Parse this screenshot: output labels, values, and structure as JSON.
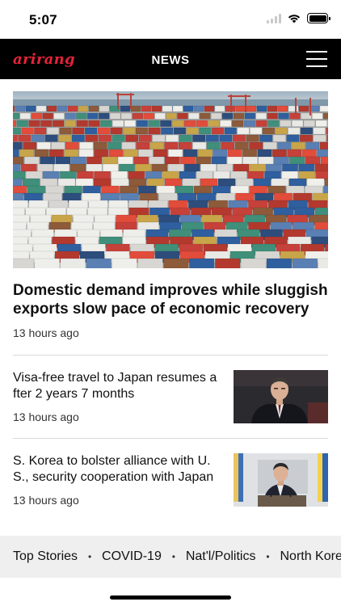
{
  "status_bar": {
    "time": "5:07"
  },
  "header": {
    "logo": "arirang",
    "title": "NEWS",
    "brand_color": "#e2233a"
  },
  "hero": {
    "title": "Domestic demand improves while sluggish exports slow pace of economic recovery",
    "time": "13 hours ago"
  },
  "articles": [
    {
      "title": "Visa-free travel to Japan resumes after 2 years 7 months",
      "time": "13 hours ago"
    },
    {
      "title": "S. Korea to bolster alliance with U.S., security cooperation with Japan",
      "time": "13 hours ago"
    }
  ],
  "categories": [
    "Top Stories",
    "COVID-19",
    "Nat'l/Politics",
    "North Korea"
  ],
  "icons": {
    "menu": "hamburger-menu-icon",
    "wifi": "wifi-icon",
    "battery": "battery-icon",
    "signal": "cellular-signal-icon"
  }
}
